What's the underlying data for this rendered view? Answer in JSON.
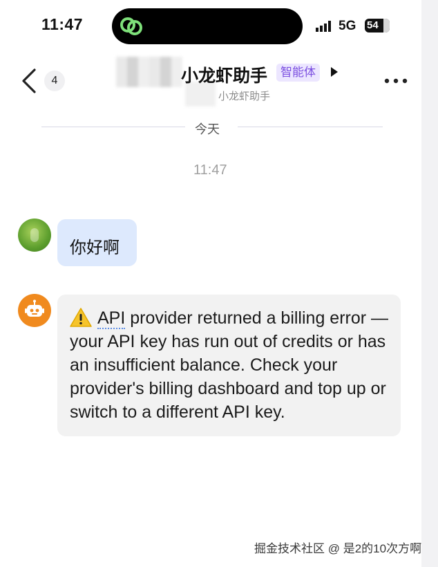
{
  "status_bar": {
    "time": "11:47",
    "network": "5G",
    "battery": "54"
  },
  "header": {
    "unread_count": "4",
    "title": "小龙虾助手",
    "agent_badge": "智能体",
    "subtitle": "小龙虾助手"
  },
  "chat": {
    "date_divider": "今天",
    "timestamp": "11:47",
    "messages": [
      {
        "sender": "user",
        "text": "你好啊"
      },
      {
        "sender": "bot",
        "text_api": "API",
        "text_rest": " provider returned a billing error — your API key has run out of credits or has an insufficient balance. Check your provider's billing dashboard and top up or switch to a different API key."
      }
    ]
  },
  "watermark": "掘金技术社区 @ 是2的10次方啊",
  "colors": {
    "user_bubble": "#dde9fd",
    "bot_bubble": "#f2f2f2",
    "agent_badge_text": "#7b4fe0",
    "agent_badge_bg": "#ece6ff",
    "bot_avatar": "#f08a1e",
    "island_icon": "#7ee07a"
  },
  "icons": [
    "back-chevron-icon",
    "link-icon",
    "signal-icon",
    "play-triangle-icon",
    "more-dots-icon",
    "robot-icon",
    "warning-icon"
  ]
}
